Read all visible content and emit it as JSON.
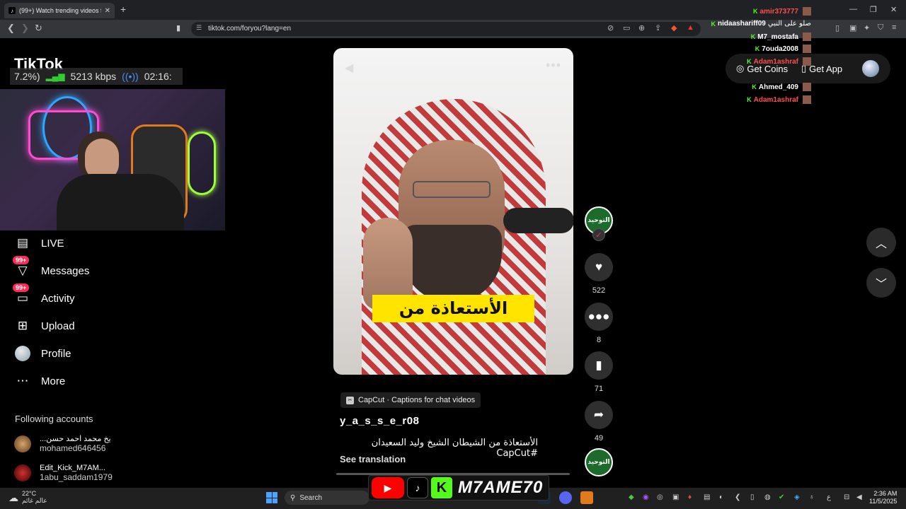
{
  "browser": {
    "tab_title": "(99+) Watch trending videos f",
    "url": "tiktok.com/foryou?lang=en"
  },
  "stream_overlay": {
    "logo": "TikTok",
    "stat_percent": "7.2%)",
    "bitrate": "5213 kbps",
    "time": "02:16:"
  },
  "sidebar": {
    "items": [
      {
        "label": "LIVE",
        "badge": ""
      },
      {
        "label": "Messages",
        "badge": "99+"
      },
      {
        "label": "Activity",
        "badge": "99+"
      },
      {
        "label": "Upload",
        "badge": ""
      },
      {
        "label": "Profile",
        "badge": ""
      },
      {
        "label": "More",
        "badge": ""
      }
    ],
    "following_title": "Following accounts",
    "following": [
      {
        "name": "...يخ محمد احمد حسن",
        "handle": "mohamed646456"
      },
      {
        "name": "Edit_Kick_M7AM...",
        "handle": "1abu_saddam1979"
      }
    ]
  },
  "video": {
    "caption_overlay": "الأستعاذة من",
    "effect_label": "CapCut · Captions for chat videos",
    "username": "y_a_s_s_e_r08",
    "description": "الأستعاذة من الشيطان الشيخ وليد السعيدان #CapCut",
    "see_translation": "See translation"
  },
  "actions": {
    "channel_avatar_text": "التوحيد",
    "likes": "522",
    "comments": "8",
    "saves": "71",
    "shares": "49"
  },
  "header": {
    "get_coins": "Get Coins",
    "get_app": "Get App"
  },
  "chat": [
    {
      "name": "amir373777",
      "color": "#ff4d4d"
    },
    {
      "name": "nidaashariff09",
      "color": "#ffffff",
      "msg": "صلو على النبي"
    },
    {
      "name": "M7_mostafa",
      "color": "#ffffff"
    },
    {
      "name": "7ouda2008",
      "color": "#ffffff"
    },
    {
      "name": "Adam1ashraf",
      "color": "#ff4d4d"
    },
    {
      "name": "Ahmed_409",
      "color": "#ffffff"
    },
    {
      "name": "Adam1ashraf",
      "color": "#ff4d4d"
    }
  ],
  "taskbar": {
    "temperature": "22°C",
    "weather_text": "عالم غائم",
    "search": "Search",
    "time": "2:36 AM",
    "date": "11/5/2025",
    "lang": "ع"
  },
  "brand": {
    "name": "M7AME70"
  }
}
